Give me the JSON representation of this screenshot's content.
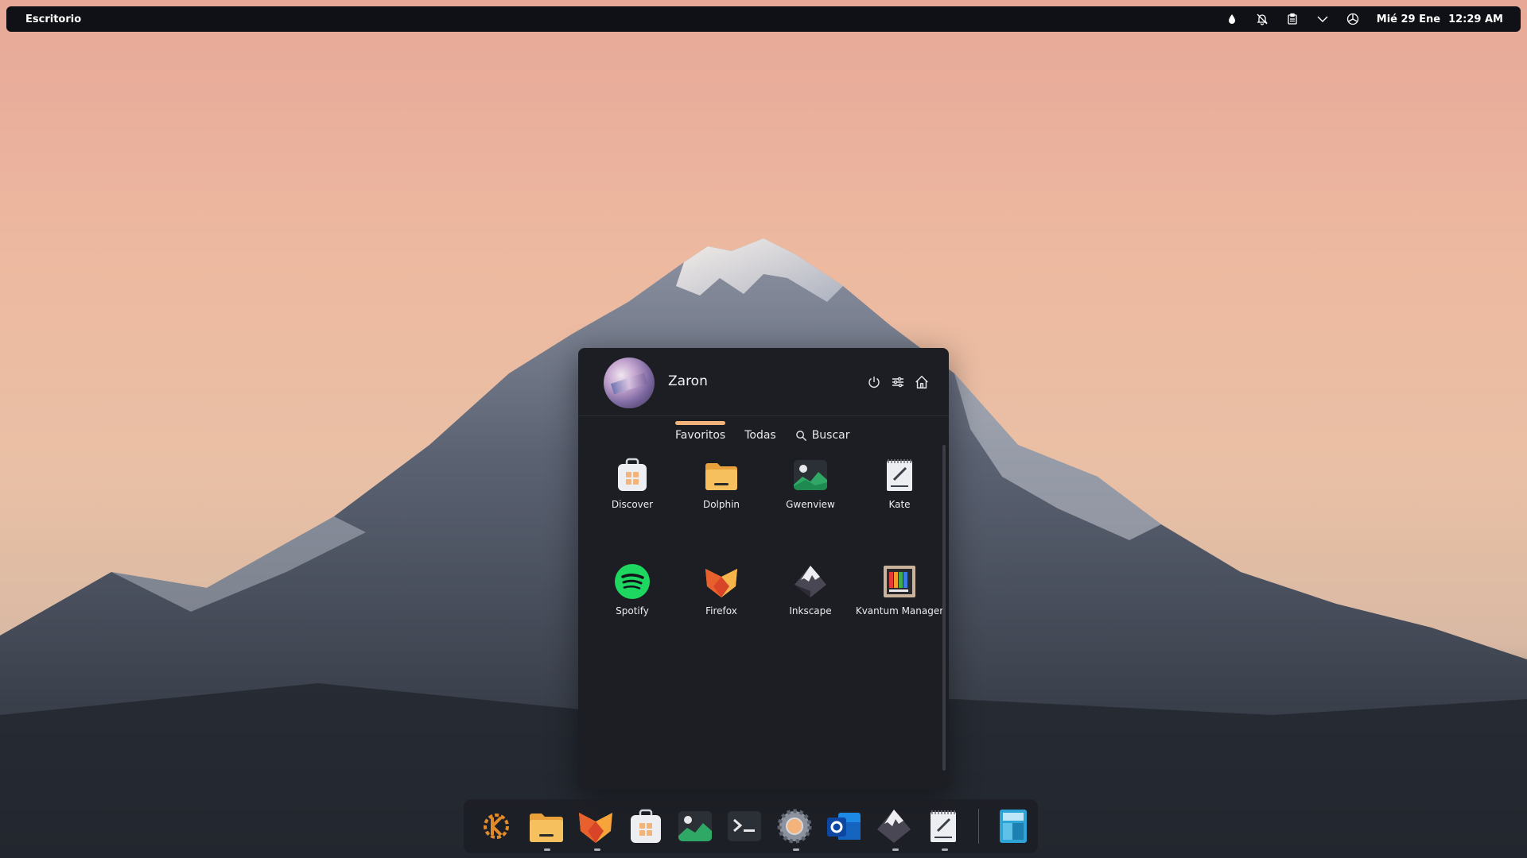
{
  "panel": {
    "left_label": "Escritorio",
    "date": "Mié 29 Ene",
    "time": "12:29 AM",
    "tray_icons": [
      "droplet-icon",
      "notifications-muted-icon",
      "clipboard-icon",
      "chevron-down-icon",
      "network-icon"
    ]
  },
  "launcher": {
    "user_name": "Zaron",
    "tabs": {
      "favorites": "Favoritos",
      "all": "Todas",
      "search": "Buscar"
    },
    "apps": [
      {
        "label": "Discover",
        "icon": "discover-icon"
      },
      {
        "label": "Dolphin",
        "icon": "dolphin-icon"
      },
      {
        "label": "Gwenview",
        "icon": "gwenview-icon"
      },
      {
        "label": "Kate",
        "icon": "kate-icon"
      },
      {
        "label": "Spotify",
        "icon": "spotify-icon"
      },
      {
        "label": "Firefox",
        "icon": "firefox-icon"
      },
      {
        "label": "Inkscape",
        "icon": "inkscape-icon"
      },
      {
        "label": "Kvantum Manager",
        "icon": "kvantum-icon"
      }
    ]
  },
  "dock": {
    "items": [
      "kde-launcher-icon",
      "dolphin-icon",
      "firefox-icon",
      "discover-icon",
      "gwenview-icon",
      "konsole-icon",
      "system-settings-icon",
      "outlook-icon",
      "inkscape-icon",
      "kate-icon",
      "kcalc-icon"
    ]
  },
  "colors": {
    "accent": "#f3b37a",
    "panel_bg": "#0f1116",
    "launcher_bg": "#1c1e24"
  }
}
